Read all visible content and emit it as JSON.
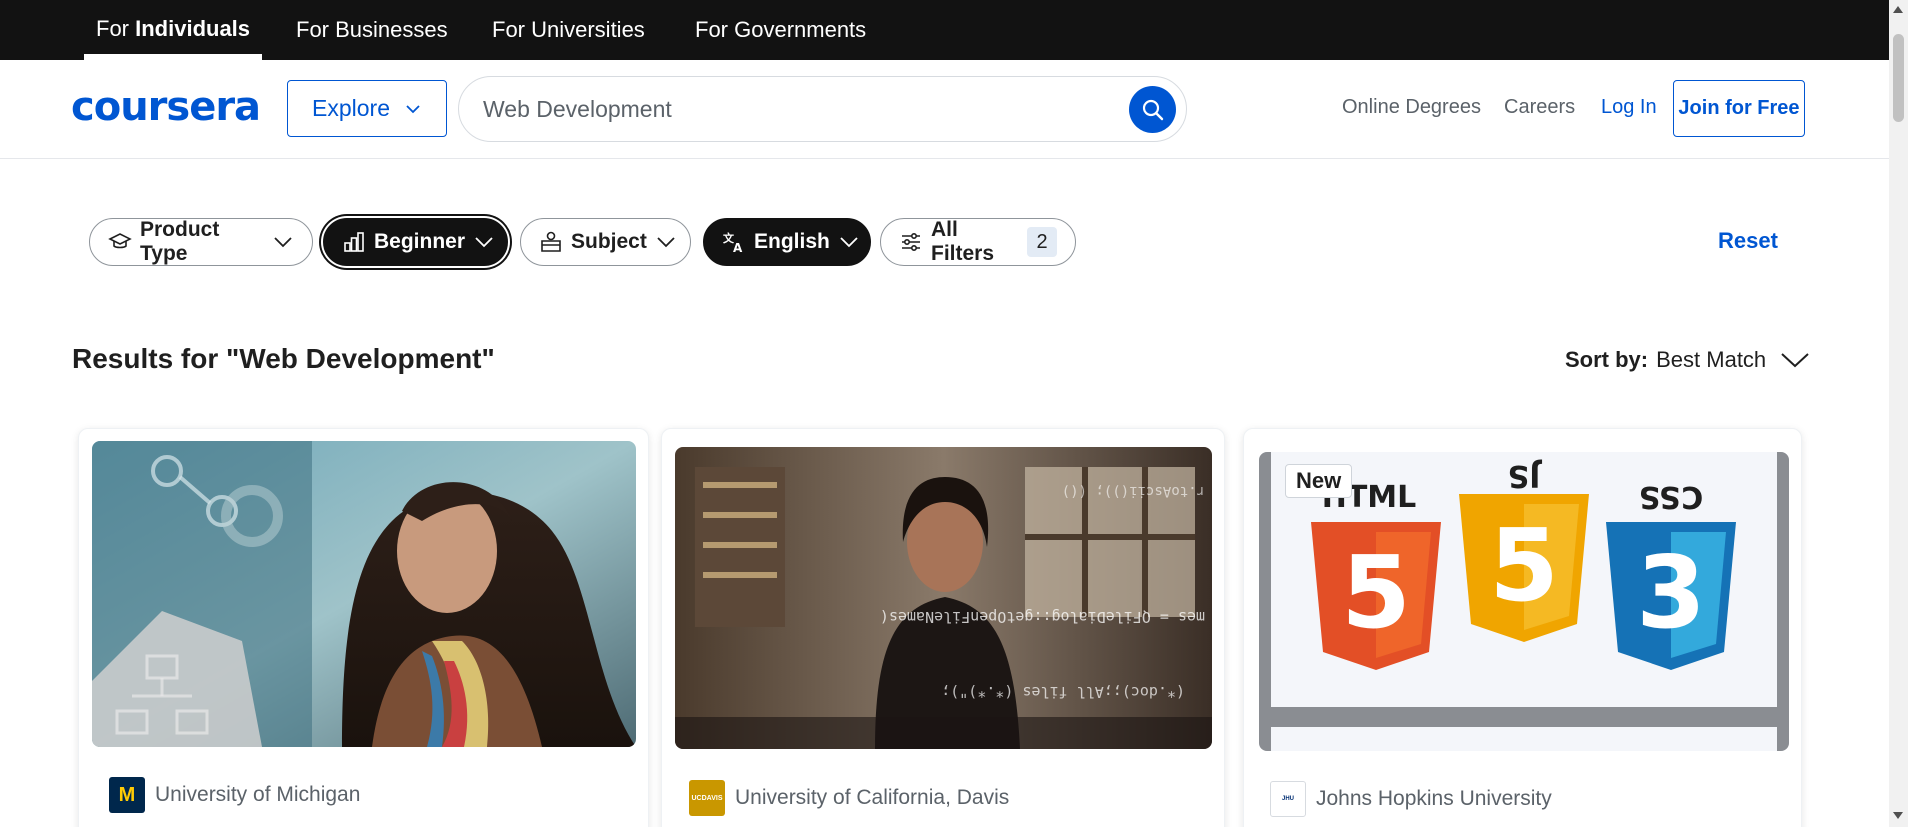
{
  "audience_tabs": [
    {
      "pre": "For ",
      "bold": "Individuals",
      "active": true
    },
    {
      "label": "For Businesses"
    },
    {
      "label": "For Universities"
    },
    {
      "label": "For Governments"
    }
  ],
  "header": {
    "logo": "coursera",
    "explore_label": "Explore",
    "search_value": "Web Development",
    "online_degrees": "Online Degrees",
    "careers": "Careers",
    "login": "Log In",
    "join": "Join for Free"
  },
  "filters": {
    "product_type": "Product Type",
    "beginner": "Beginner",
    "subject": "Subject",
    "english": "English",
    "all_filters": "All Filters",
    "all_filters_count": "2",
    "reset": "Reset"
  },
  "results": {
    "title": "Results for \"Web Development\"",
    "sort_label": "Sort by:",
    "sort_value": "Best Match"
  },
  "cards": [
    {
      "partner": "University of Michigan",
      "badge": ""
    },
    {
      "partner": "University of California, Davis",
      "badge": ""
    },
    {
      "partner": "Johns Hopkins University",
      "badge": "New",
      "thumb_text": [
        "HTML",
        "JS",
        "CSS"
      ]
    }
  ],
  "colors": {
    "brand": "#0056d2",
    "topbar": "#121212",
    "michigan_blue": "#00274c",
    "michigan_maize": "#ffcb05",
    "ucdavis_gold": "#c99700",
    "html_orange": "#e34f26",
    "js_yellow": "#f0a500",
    "css_blue": "#1572b6"
  }
}
